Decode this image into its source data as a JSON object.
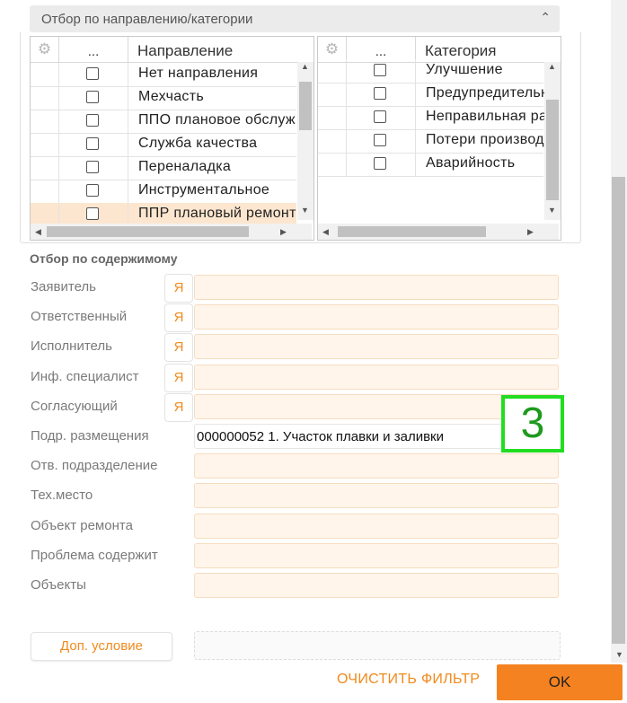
{
  "direction_section": {
    "title": "Отбор по направлению/категории",
    "collapse_icon": "chevron-up-icon"
  },
  "direction_grid": {
    "gear_icon": "gear-icon",
    "dots": "...",
    "header": "Направление",
    "rows": [
      {
        "label": "Нет направления",
        "checked": false
      },
      {
        "label": "Мехчасть",
        "checked": false
      },
      {
        "label": "ППО плановое обслуж",
        "checked": false
      },
      {
        "label": "Служба качества",
        "checked": false
      },
      {
        "label": "Переналадка",
        "checked": false
      },
      {
        "label": "Инструментальное",
        "checked": false
      },
      {
        "label": "ППР плановый ремонт",
        "checked": false,
        "selected": true
      }
    ]
  },
  "category_grid": {
    "gear_icon": "gear-icon",
    "dots": "...",
    "header": "Категория",
    "rows": [
      {
        "label": "Улучшение",
        "checked": false
      },
      {
        "label": "Предупредительный",
        "checked": false
      },
      {
        "label": "Неправильная работа",
        "checked": false
      },
      {
        "label": "Потери производства",
        "checked": false
      },
      {
        "label": "Аварийность",
        "checked": false
      }
    ]
  },
  "content_section": {
    "title": "Отбор по содержимому",
    "self_button_label": "Я",
    "fields": [
      {
        "label": "Заявитель",
        "value": "",
        "has_self_button": true
      },
      {
        "label": "Ответственный",
        "value": "",
        "has_self_button": true
      },
      {
        "label": "Исполнитель",
        "value": "",
        "has_self_button": true
      },
      {
        "label": "Инф. специалист",
        "value": "",
        "has_self_button": true
      },
      {
        "label": "Согласующий",
        "value": "",
        "has_self_button": true
      },
      {
        "label": "Подр. размещения",
        "value": "000000052 1. Участок плавки и заливки",
        "has_self_button": false
      },
      {
        "label": "Отв. подразделение",
        "value": "",
        "has_self_button": false
      },
      {
        "label": "Тех.место",
        "value": "",
        "has_self_button": false
      },
      {
        "label": "Объект ремонта",
        "value": "",
        "has_self_button": false
      },
      {
        "label": "Проблема содержит",
        "value": "",
        "has_self_button": false
      },
      {
        "label": "Объекты",
        "value": "",
        "has_self_button": false
      }
    ]
  },
  "marker": {
    "text": "3",
    "color": "#22dd22"
  },
  "footer": {
    "extra_condition_label": "Доп. условие",
    "clear_filter_label": "ОЧИСТИТЬ ФИЛЬТР",
    "ok_label": "OK"
  },
  "colors": {
    "accent": "#f58220",
    "field_bg": "#fff5ea",
    "selected_row": "#fde6cf"
  }
}
